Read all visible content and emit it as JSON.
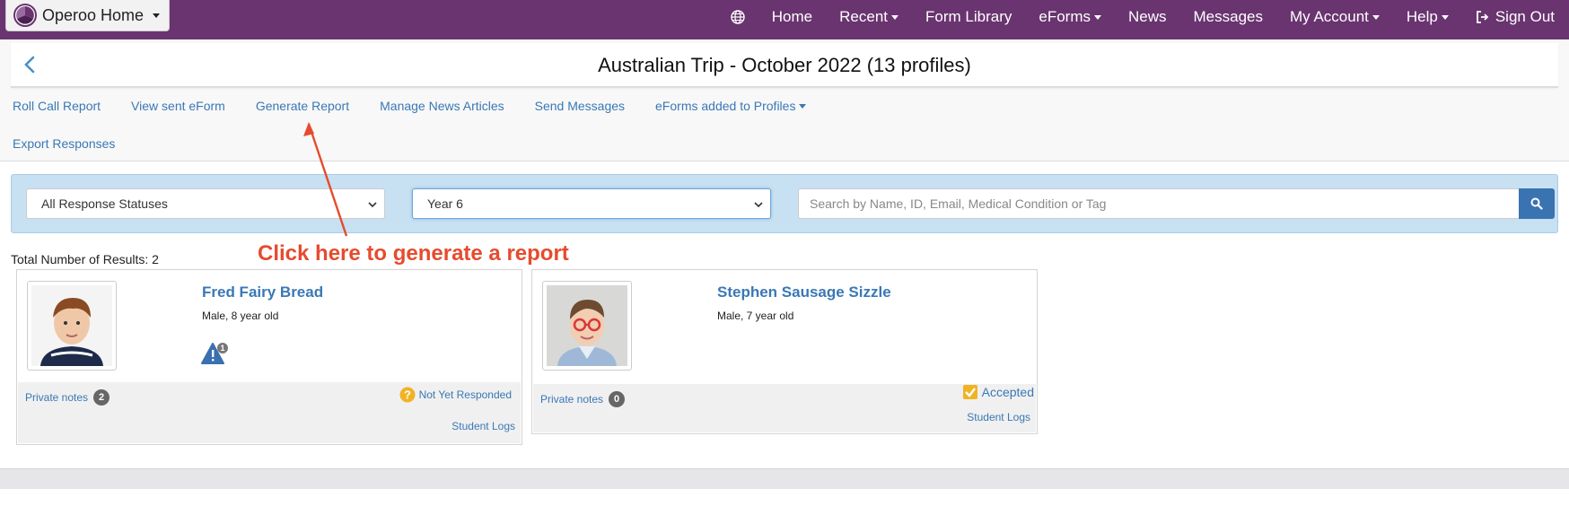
{
  "nav": {
    "brand": "Operoo Home",
    "items": [
      {
        "label": "Home"
      },
      {
        "label": "Recent",
        "dropdown": true
      },
      {
        "label": "Form Library"
      },
      {
        "label": "eForms",
        "dropdown": true
      },
      {
        "label": "News"
      },
      {
        "label": "Messages"
      },
      {
        "label": "My Account",
        "dropdown": true
      },
      {
        "label": "Help",
        "dropdown": true
      }
    ],
    "sign_out": "Sign Out"
  },
  "page": {
    "title": "Australian Trip - October 2022 (13 profiles)"
  },
  "subnav": {
    "roll_call": "Roll Call Report",
    "view_sent": "View sent eForm",
    "generate_report": "Generate Report",
    "manage_news": "Manage News Articles",
    "send_messages": "Send Messages",
    "eforms_added": "eForms added to Profiles",
    "export_responses": "Export Responses"
  },
  "filters": {
    "status_select": "All Response Statuses",
    "group_select": "Year 6",
    "search_placeholder": "Search by Name, ID, Email, Medical Condition or Tag"
  },
  "results": {
    "count_label": "Total Number of Results: 2"
  },
  "annotation": {
    "text": "Click here to generate a report",
    "color": "#e64b2e"
  },
  "students": [
    {
      "name": "Fred Fairy Bread",
      "meta": "Male, 8 year old",
      "alert_count": "1",
      "notes_label": "Private notes",
      "notes_count": "2",
      "status": "Not Yet Responded",
      "logs": "Student Logs"
    },
    {
      "name": "Stephen Sausage Sizzle",
      "meta": "Male, 7 year old",
      "notes_label": "Private notes",
      "notes_count": "0",
      "status": "Accepted",
      "logs": "Student Logs"
    }
  ],
  "colors": {
    "nav_bg": "#69346f",
    "link": "#3a78b5",
    "filter_bg": "#c7e0f2",
    "search_btn": "#3a73b1",
    "annotation": "#e64b2e"
  }
}
